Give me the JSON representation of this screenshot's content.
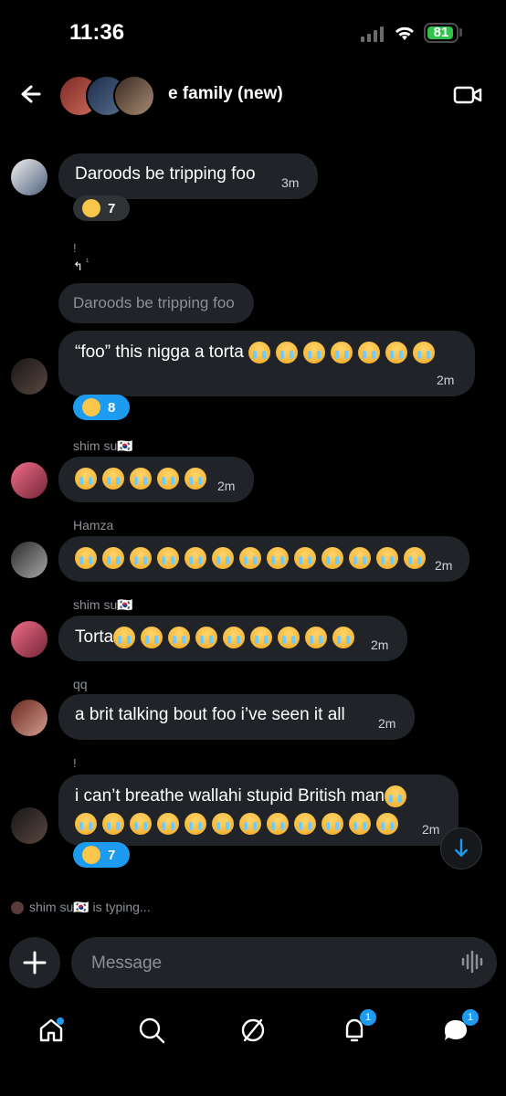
{
  "status": {
    "time": "11:36",
    "battery": "81"
  },
  "header": {
    "title": "e family (new)"
  },
  "messages": [
    {
      "id": "m1",
      "text": "Daroods be tripping foo",
      "time": "3m",
      "reaction_count": "7"
    },
    {
      "id": "m2",
      "text": "“foo” this nigga a torta",
      "time": "2m",
      "reaction_count": "8"
    },
    {
      "id": "m3",
      "sender": "shim su🇰🇷",
      "time": "2m"
    },
    {
      "id": "m4",
      "sender": "Hamza",
      "time": "2m"
    },
    {
      "id": "m5",
      "sender": "shim su🇰🇷",
      "text": "Torta",
      "time": "2m"
    },
    {
      "id": "m6",
      "sender": "qq",
      "text": "a brit talking bout foo i’ve seen it all",
      "time": "2m"
    },
    {
      "id": "m7",
      "text": "i can’t breathe wallahi stupid British man",
      "time": "2m",
      "reaction_count": "7"
    }
  ],
  "reply": {
    "text": "Daroods be tripping foo"
  },
  "markers": {
    "exclaim1": "!",
    "exclaim2": "!",
    "tiny": "¹"
  },
  "typing": {
    "text": "shim su🇰🇷 is typing..."
  },
  "composer": {
    "placeholder": "Message"
  },
  "tabs": {
    "notifications_badge": "1",
    "messages_badge": "1"
  }
}
